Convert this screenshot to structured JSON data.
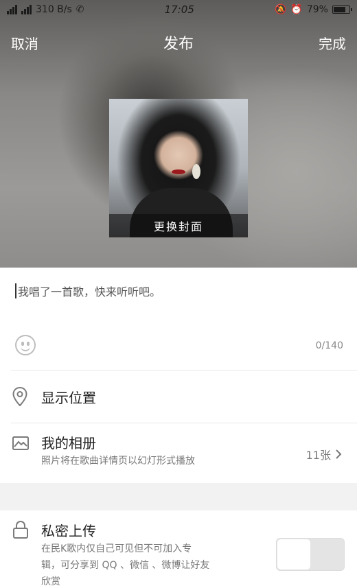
{
  "status_bar": {
    "network_left": "4G",
    "network_right": "4G",
    "speed": "310 B/s",
    "time": "17:05",
    "battery": "79%",
    "battery_level": 0.79
  },
  "nav": {
    "cancel_label": "取消",
    "title": "发布",
    "done_label": "完成"
  },
  "cover": {
    "change_label": "更换封面"
  },
  "caption": {
    "text": "我唱了一首歌，快来听听吧。"
  },
  "char_counter": "0/140",
  "location": {
    "label": "显示位置"
  },
  "album": {
    "title": "我的相册",
    "subtitle": "照片将在歌曲详情页以幻灯形式播放",
    "count": "11张"
  },
  "private_upload": {
    "title": "私密上传",
    "description_line1": "在民K歌内仅自己可见但不可加入专",
    "description_line2": "辑，可分享到 QQ 、微信 、微博让好友",
    "description_line3": "欣赏",
    "enabled": false
  }
}
